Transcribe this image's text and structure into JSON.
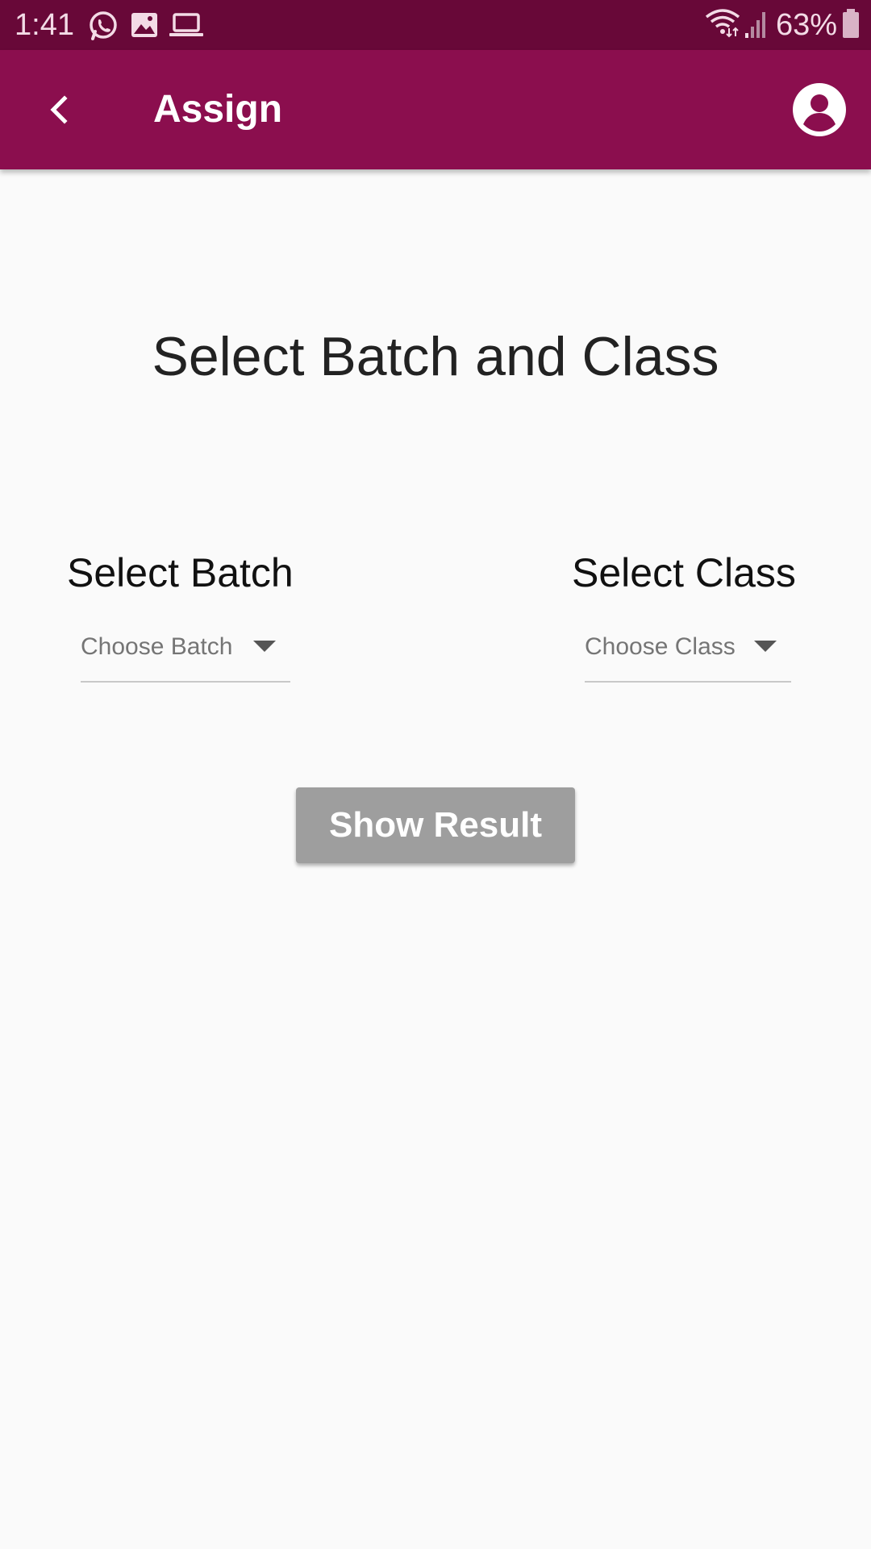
{
  "status_bar": {
    "time": "1:41",
    "battery": "63%",
    "icons": [
      "whatsapp-icon",
      "image-icon",
      "laptop-icon",
      "wifi-icon",
      "signal-icon",
      "battery-icon"
    ],
    "background_color": "#680838"
  },
  "app_bar": {
    "title": "Assign",
    "background_color": "#8b0e4e",
    "back_icon": "chevron-left-icon",
    "profile_icon": "account-circle-icon"
  },
  "main": {
    "heading": "Select Batch and Class",
    "batch": {
      "label": "Select Batch",
      "dropdown_placeholder": "Choose Batch"
    },
    "class": {
      "label": "Select Class",
      "dropdown_placeholder": "Choose Class"
    },
    "show_result_label": "Show Result",
    "button_color": "#9e9e9e"
  }
}
